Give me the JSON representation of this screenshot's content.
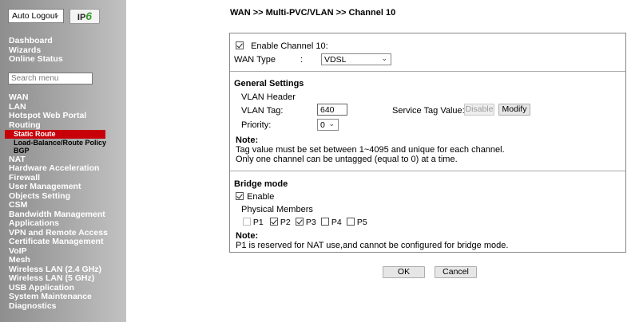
{
  "sidebar": {
    "logout_select": "Auto Logout",
    "ip6_prefix": "IP",
    "ip6_suffix": "6",
    "top_items": [
      "Dashboard",
      "Wizards",
      "Online Status"
    ],
    "search_placeholder": "Search menu",
    "items_a": [
      "WAN",
      "LAN",
      "Hotspot Web Portal",
      "Routing"
    ],
    "sub_items": [
      "Static Route",
      "Load-Balance/Route Policy",
      "BGP"
    ],
    "items_b": [
      "NAT",
      "Hardware Acceleration",
      "Firewall",
      "User Management",
      "Objects Setting",
      "CSM",
      "Bandwidth Management",
      "Applications",
      "VPN and Remote Access",
      "Certificate Management",
      "VoIP",
      "Mesh",
      "Wireless LAN (2.4 GHz)",
      "Wireless LAN (5 GHz)",
      "USB Application",
      "System Maintenance",
      "Diagnostics"
    ]
  },
  "breadcrumb": "WAN >> Multi-PVC/VLAN >> Channel 10",
  "panel": {
    "enable_channel_label": "Enable Channel 10:",
    "wan_type_label": "WAN Type",
    "wan_type_colon": ":",
    "wan_type_value": "VDSL",
    "general_settings_title": "General Settings",
    "vlan_header_label": "VLAN Header",
    "vlan_tag_label": "VLAN Tag:",
    "vlan_tag_value": "640",
    "service_tag_label": "Service Tag Value:",
    "disable_button": "Disable",
    "modify_button": "Modify",
    "priority_label": "Priority:",
    "priority_value": "0",
    "note1_title": "Note:",
    "note1_line1": "Tag value must be set between 1~4095 and unique for each channel.",
    "note1_line2": "Only one channel can be untagged (equal to 0) at a time.",
    "bridge_mode_title": "Bridge mode",
    "enable_label": "Enable",
    "physical_members_label": "Physical Members",
    "members": [
      "P1",
      "P2",
      "P3",
      "P4",
      "P5"
    ],
    "note2_title": "Note:",
    "note2_line": "P1 is reserved for NAT use,and cannot be configured for bridge mode."
  },
  "footer": {
    "ok_button": "OK",
    "cancel_button": "Cancel"
  }
}
